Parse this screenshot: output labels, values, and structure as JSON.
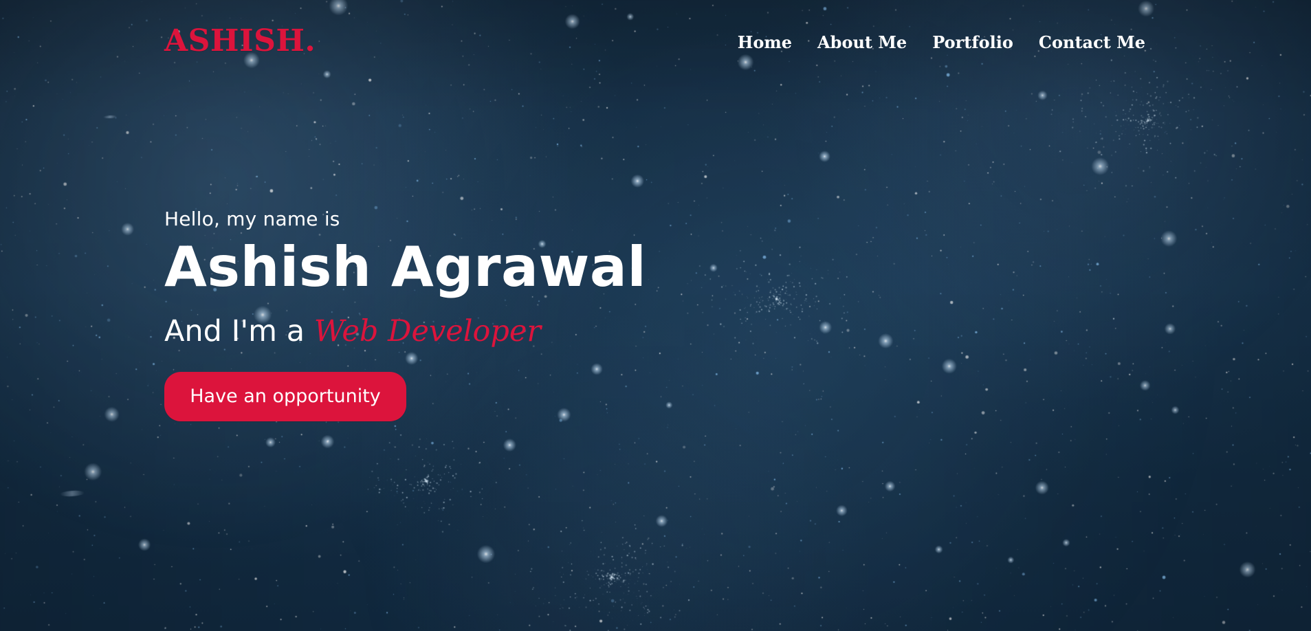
{
  "site": {
    "logo": "ASHISH.",
    "accent_color": "#dc143c"
  },
  "nav": {
    "items": [
      {
        "label": "Home"
      },
      {
        "label": "About Me"
      },
      {
        "label": "Portfolio"
      },
      {
        "label": "Contact Me"
      }
    ]
  },
  "hero": {
    "greeting": "Hello, my name is",
    "name": "Ashish Agrawal",
    "role_prefix": "And I'm a",
    "role_highlight": "Web Developer",
    "cta_label": "Have an opportunity"
  },
  "background": {
    "theme": "starry-night"
  }
}
